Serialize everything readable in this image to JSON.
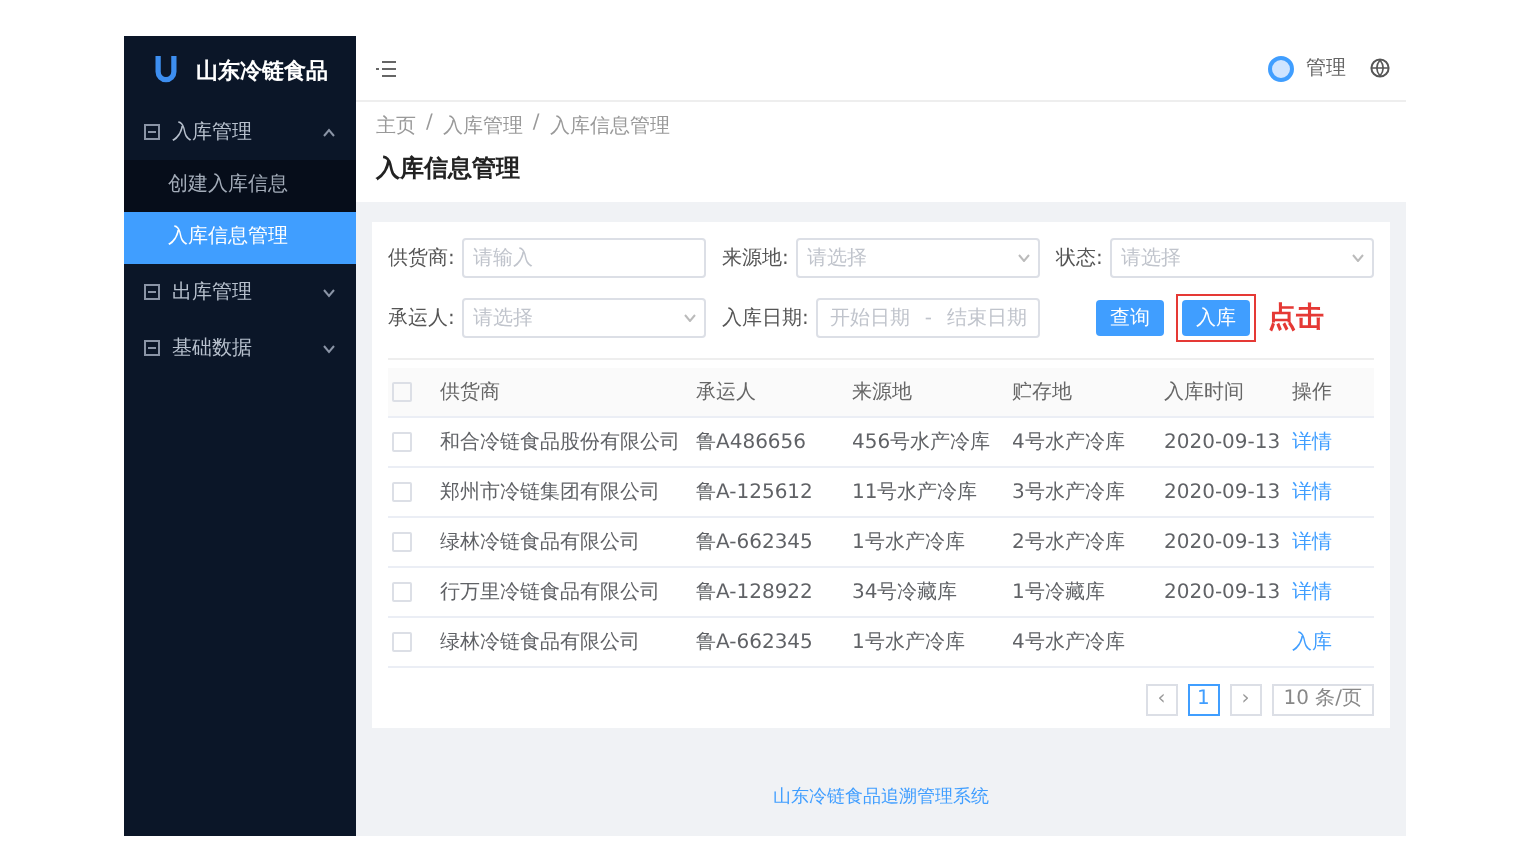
{
  "sidebar": {
    "brand": "山东冷链食品",
    "items": [
      {
        "label": "入库管理",
        "expanded": true,
        "children": [
          {
            "label": "创建入库信息",
            "selected": false
          },
          {
            "label": "入库信息管理",
            "selected": true
          }
        ]
      },
      {
        "label": "出库管理",
        "expanded": false
      },
      {
        "label": "基础数据",
        "expanded": false
      }
    ]
  },
  "header": {
    "user": "管理"
  },
  "breadcrumb": {
    "items": [
      "主页",
      "入库管理",
      "入库信息管理"
    ],
    "separator": "/"
  },
  "page_title": "入库信息管理",
  "filters": [
    {
      "label": "供货商:",
      "kind": "input",
      "placeholder": "请输入"
    },
    {
      "label": "来源地:",
      "kind": "select",
      "placeholder": "请选择"
    },
    {
      "label": "状态:",
      "kind": "select",
      "placeholder": "请选择"
    },
    {
      "label": "承运人:",
      "kind": "select",
      "placeholder": "请选择"
    },
    {
      "label": "入库日期:",
      "kind": "daterange",
      "placeholder": "开始日期",
      "placeholder_end": "结束日期",
      "separator": "-"
    }
  ],
  "buttons": [
    {
      "label": "查询",
      "highlighted": false
    },
    {
      "label": "入库",
      "highlighted": true
    }
  ],
  "annotation": "点击",
  "table": {
    "all_checked": false,
    "columns": [
      "供货商",
      "承运人",
      "来源地",
      "贮存地",
      "入库时间",
      "操作"
    ],
    "rows": [
      {
        "checked": false,
        "cells": [
          "和合冷链食品股份有限公司",
          "鲁A486656",
          "456号水产冷库",
          "4号水产冷库",
          "2020-09-13"
        ],
        "action": "详情"
      },
      {
        "checked": false,
        "cells": [
          "郑州市冷链集团有限公司",
          "鲁A-125612",
          "11号水产冷库",
          "3号水产冷库",
          "2020-09-13"
        ],
        "action": "详情"
      },
      {
        "checked": false,
        "cells": [
          "绿林冷链食品有限公司",
          "鲁A-662345",
          "1号水产冷库",
          "2号水产冷库",
          "2020-09-13"
        ],
        "action": "详情"
      },
      {
        "checked": false,
        "cells": [
          "行万里冷链食品有限公司",
          "鲁A-128922",
          "34号冷藏库",
          "1号冷藏库",
          "2020-09-13"
        ],
        "action": "详情"
      },
      {
        "checked": false,
        "cells": [
          "绿林冷链食品有限公司",
          "鲁A-662345",
          "1号水产冷库",
          "4号水产冷库",
          ""
        ],
        "action": "入库"
      }
    ]
  },
  "pagination": {
    "prev": "‹",
    "pages": [
      {
        "label": "1",
        "selected": true
      }
    ],
    "next": "›",
    "page_size": "10 条/页"
  },
  "footer": "山东冷链食品追溯管理系统"
}
